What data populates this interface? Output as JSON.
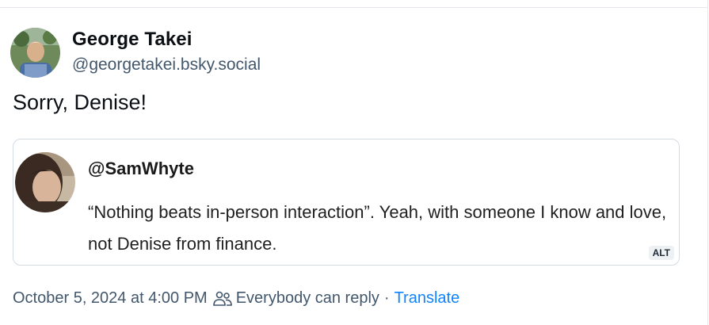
{
  "post": {
    "author_name": "George Takei",
    "author_handle": "@georgetakei.bsky.social",
    "text": "Sorry, Denise!",
    "avatar_icon": "user-photo-avatar"
  },
  "embed": {
    "handle": "@SamWhyte",
    "quote": "“Nothing beats in-person interaction”. Yeah, with someone I know and love, not Denise from finance.",
    "alt_badge": "ALT",
    "avatar_icon": "user-photo-avatar"
  },
  "meta": {
    "timestamp": "October 5, 2024 at 4:00 PM",
    "reply_setting": "Everybody can reply",
    "separator": "·",
    "translate_label": "Translate",
    "reply_icon": "people-icon"
  },
  "colors": {
    "link": "#1083fe",
    "secondary_text": "#42576c",
    "border": "#d4dbe2"
  }
}
